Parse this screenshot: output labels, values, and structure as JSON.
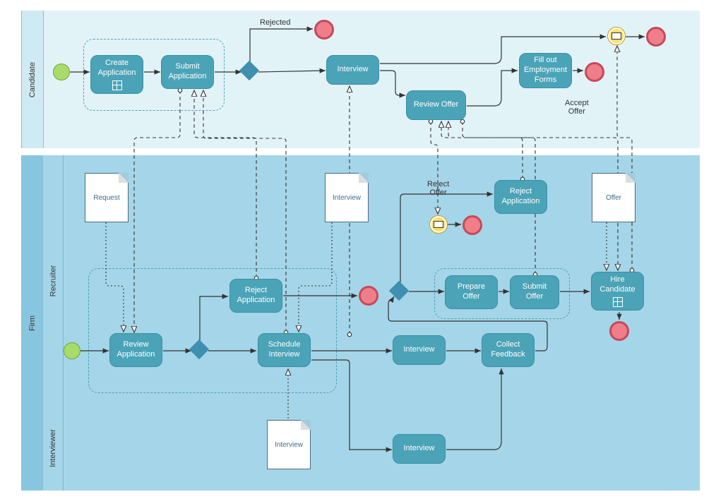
{
  "pools": {
    "candidate": "Candidate",
    "firm": "Firm"
  },
  "lanes": {
    "recruiter": "Recruiter",
    "interviewer": "Interviewer"
  },
  "tasks": {
    "create_app": "Create\nApplication",
    "submit_app": "Submit\nApplication",
    "interview_c": "Interview",
    "review_offer_c": "Review Offer",
    "fill_forms": "Fill out\nEmployment\nForms",
    "review_app": "Review\nApplication",
    "reject_app_r": "Reject\nApplication",
    "schedule_int": "Schedule\nInterview",
    "interview_r": "Interview",
    "collect_fb": "Collect\nFeedback",
    "prepare_offer": "Prepare\nOffer",
    "submit_offer": "Submit\nOffer",
    "reject_app_r2": "Reject\nApplication",
    "hire_cand": "Hire\nCandidate",
    "interview_i": "Interview"
  },
  "labels": {
    "rejected": "Rejected",
    "accept_offer": "Accept\nOffer",
    "reject_offer": "Reject\nOffer"
  },
  "docs": {
    "request": "Request",
    "interview1": "Interview",
    "interview2": "Interview",
    "offer": "Offer"
  },
  "chart_data": {
    "type": "bpmn",
    "title": "Hiring Process BPMN",
    "pools": [
      {
        "name": "Candidate",
        "lanes": [
          {
            "name": "Candidate",
            "elements": [
              {
                "id": "c_start",
                "type": "start-event"
              },
              {
                "id": "c_create",
                "type": "task",
                "label": "Create Application",
                "marker": "subprocess"
              },
              {
                "id": "c_submit",
                "type": "task",
                "label": "Submit Application"
              },
              {
                "id": "c_gw",
                "type": "exclusive-gateway"
              },
              {
                "id": "c_end_rej",
                "type": "end-event",
                "label": "Rejected"
              },
              {
                "id": "c_interview",
                "type": "task",
                "label": "Interview"
              },
              {
                "id": "c_review_offer",
                "type": "task",
                "label": "Review Offer"
              },
              {
                "id": "c_fill_forms",
                "type": "task",
                "label": "Fill out Employment Forms"
              },
              {
                "id": "c_end_forms",
                "type": "end-event"
              },
              {
                "id": "c_msg",
                "type": "intermediate-message-event"
              },
              {
                "id": "c_end_msg",
                "type": "end-event"
              }
            ],
            "subprocess_groups": [
              [
                "c_create",
                "c_submit"
              ]
            ]
          }
        ]
      },
      {
        "name": "Firm",
        "lanes": [
          {
            "name": "Recruiter",
            "elements": [
              {
                "id": "r_start",
                "type": "start-event"
              },
              {
                "id": "r_review",
                "type": "task",
                "label": "Review Application"
              },
              {
                "id": "r_gw1",
                "type": "exclusive-gateway"
              },
              {
                "id": "r_reject",
                "type": "task",
                "label": "Reject Application"
              },
              {
                "id": "r_end_rej",
                "type": "end-event"
              },
              {
                "id": "r_schedule",
                "type": "task",
                "label": "Schedule Interview"
              },
              {
                "id": "r_interview",
                "type": "task",
                "label": "Interview"
              },
              {
                "id": "r_collect",
                "type": "task",
                "label": "Collect Feedback"
              },
              {
                "id": "r_gw2",
                "type": "exclusive-gateway"
              },
              {
                "id": "r_prepare",
                "type": "task",
                "label": "Prepare Offer"
              },
              {
                "id": "r_submit_offer",
                "type": "task",
                "label": "Submit Offer"
              },
              {
                "id": "r_msg_reject_offer",
                "type": "intermediate-message-event",
                "label": "Reject Offer"
              },
              {
                "id": "r_end_reject_offer",
                "type": "end-event"
              },
              {
                "id": "r_reject_app2",
                "type": "task",
                "label": "Reject Application"
              },
              {
                "id": "r_hire",
                "type": "task",
                "label": "Hire Candidate",
                "marker": "subprocess"
              },
              {
                "id": "r_end_hire",
                "type": "end-event"
              }
            ],
            "subprocess_groups": [
              [
                "r_review",
                "r_gw1",
                "r_reject",
                "r_schedule"
              ],
              [
                "r_prepare",
                "r_submit_offer"
              ]
            ],
            "data_objects": [
              "Request",
              "Interview",
              "Offer"
            ]
          },
          {
            "name": "Interviewer",
            "elements": [
              {
                "id": "i_interview",
                "type": "task",
                "label": "Interview"
              }
            ],
            "data_objects": [
              "Interview"
            ]
          }
        ]
      }
    ],
    "sequence_flows": [
      [
        "c_start",
        "c_create"
      ],
      [
        "c_create",
        "c_submit"
      ],
      [
        "c_submit",
        "c_gw"
      ],
      [
        "c_gw",
        "c_end_rej",
        "Rejected"
      ],
      [
        "c_gw",
        "c_interview"
      ],
      [
        "c_interview",
        "c_review_offer"
      ],
      [
        "c_interview",
        "c_msg"
      ],
      [
        "c_msg",
        "c_end_msg"
      ],
      [
        "c_review_offer",
        "c_fill_forms",
        "Accept Offer"
      ],
      [
        "c_fill_forms",
        "c_end_forms"
      ],
      [
        "r_start",
        "r_review"
      ],
      [
        "r_review",
        "r_gw1"
      ],
      [
        "r_gw1",
        "r_reject"
      ],
      [
        "r_reject",
        "r_end_rej"
      ],
      [
        "r_gw1",
        "r_schedule"
      ],
      [
        "r_schedule",
        "r_interview"
      ],
      [
        "r_interview",
        "r_collect"
      ],
      [
        "r_schedule",
        "i_interview"
      ],
      [
        "i_interview",
        "r_collect"
      ],
      [
        "r_collect",
        "r_gw2"
      ],
      [
        "r_gw2",
        "r_prepare"
      ],
      [
        "r_prepare",
        "r_submit_offer"
      ],
      [
        "r_gw2",
        "r_reject_app2"
      ],
      [
        "r_submit_offer",
        "r_hire"
      ],
      [
        "r_hire",
        "r_end_hire"
      ],
      [
        "r_msg_reject_offer",
        "r_end_reject_offer"
      ]
    ],
    "message_flows": [
      [
        "c_submit",
        "r_review"
      ],
      [
        "r_reject",
        "c_submit"
      ],
      [
        "r_schedule",
        "c_submit"
      ],
      [
        "r_interview",
        "c_interview"
      ],
      [
        "r_submit_offer",
        "c_review_offer"
      ],
      [
        "r_reject_app2",
        "c_review_offer"
      ],
      [
        "c_review_offer",
        "r_msg_reject_offer",
        "Reject Offer"
      ],
      [
        "c_review_offer",
        "r_hire",
        "Accept Offer"
      ],
      [
        "r_hire",
        "c_msg"
      ]
    ]
  }
}
